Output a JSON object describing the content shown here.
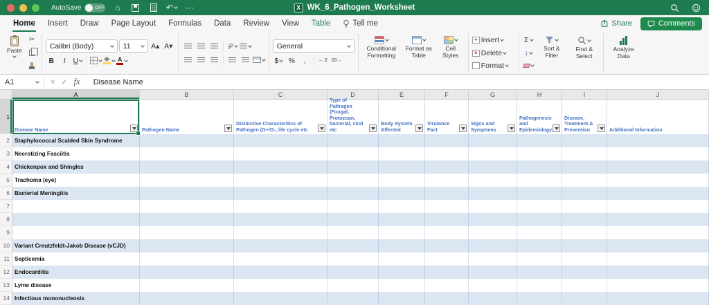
{
  "colors": {
    "accent_green": "#1e7b50",
    "comments_green": "#1f8a4e",
    "table_band_blue": "#dce6f2",
    "header_text_blue": "#4472c4"
  },
  "titlebar": {
    "autosave_label": "AutoSave",
    "autosave_state": "OFF",
    "doc_title": "WK_6_Pathogen_Worksheet"
  },
  "tabs": [
    "Home",
    "Insert",
    "Draw",
    "Page Layout",
    "Formulas",
    "Data",
    "Review",
    "View",
    "Table",
    "Tell me"
  ],
  "actions": {
    "share": "Share",
    "comments": "Comments"
  },
  "glyphs": {
    "home": "⌂",
    "undo": "↶",
    "more": "···",
    "scissors": "✂",
    "grow_font": "A▴",
    "shrink_font": "A▾",
    "bold": "B",
    "italic": "I",
    "underline": "U",
    "orientation": "ab",
    "autosum": "Σ",
    "fill_down": "↓",
    "cancel": "×",
    "confirm": "✓",
    "currency": "$",
    "percent": "%",
    "comma": ",",
    "decimal_increase": "←.0",
    "decimal_decrease": ".00→",
    "insert_plus": "+",
    "delete_x": "×",
    "format_box": "▦"
  },
  "ribbon": {
    "paste_label": "Paste",
    "font_name": "Calibri (Body)",
    "font_size": "11",
    "number_format": "General",
    "conditional_formatting": "Conditional Formatting",
    "format_as_table": "Format as Table",
    "cell_styles": "Cell Styles",
    "insert_label": "Insert",
    "delete_label": "Delete",
    "format_label": "Format",
    "sort_filter": "Sort & Filter",
    "find_select": "Find & Select",
    "analyze_data": "Analyze Data"
  },
  "formula_bar": {
    "cell_ref": "A1",
    "fx": "fx",
    "value": "Disease Name"
  },
  "sheet": {
    "row1_number": "1",
    "columns": [
      "A",
      "B",
      "C",
      "D",
      "E",
      "F",
      "G",
      "H",
      "I",
      "J"
    ],
    "headers": [
      "Disease Name",
      "Pathogen Name",
      "Distinctive Characteritics of Pathogen (G+/G-, life cycle etc",
      "Type of Pathogen (Fungal, Protozoan, bacterial, viral etc",
      "Body System Affected",
      "Virulance Fact",
      "Signs and Symptoms",
      "Pathogenesis and Epidemiology",
      "Disease, Treatment & Prevention",
      "Additional Information"
    ],
    "rows": [
      {
        "n": 2,
        "disease": "Staphylococcal Scalded Skin Syndrome"
      },
      {
        "n": 3,
        "disease": "Necrotizing Fasciitis"
      },
      {
        "n": 4,
        "disease": "Chickenpox and Shingles"
      },
      {
        "n": 5,
        "disease": "Trachoma (eye)"
      },
      {
        "n": 6,
        "disease": "Bacterial Meningitis"
      },
      {
        "n": 7,
        "disease": ""
      },
      {
        "n": 8,
        "disease": ""
      },
      {
        "n": 9,
        "disease": ""
      },
      {
        "n": 10,
        "disease": "Variant Creutzfeldt-Jakob Disease (vCJD)"
      },
      {
        "n": 11,
        "disease": "Septicemia"
      },
      {
        "n": 12,
        "disease": "Endocarditis"
      },
      {
        "n": 13,
        "disease": "Lyme disease"
      },
      {
        "n": 14,
        "disease": "Infectious mononucleosis"
      }
    ]
  }
}
